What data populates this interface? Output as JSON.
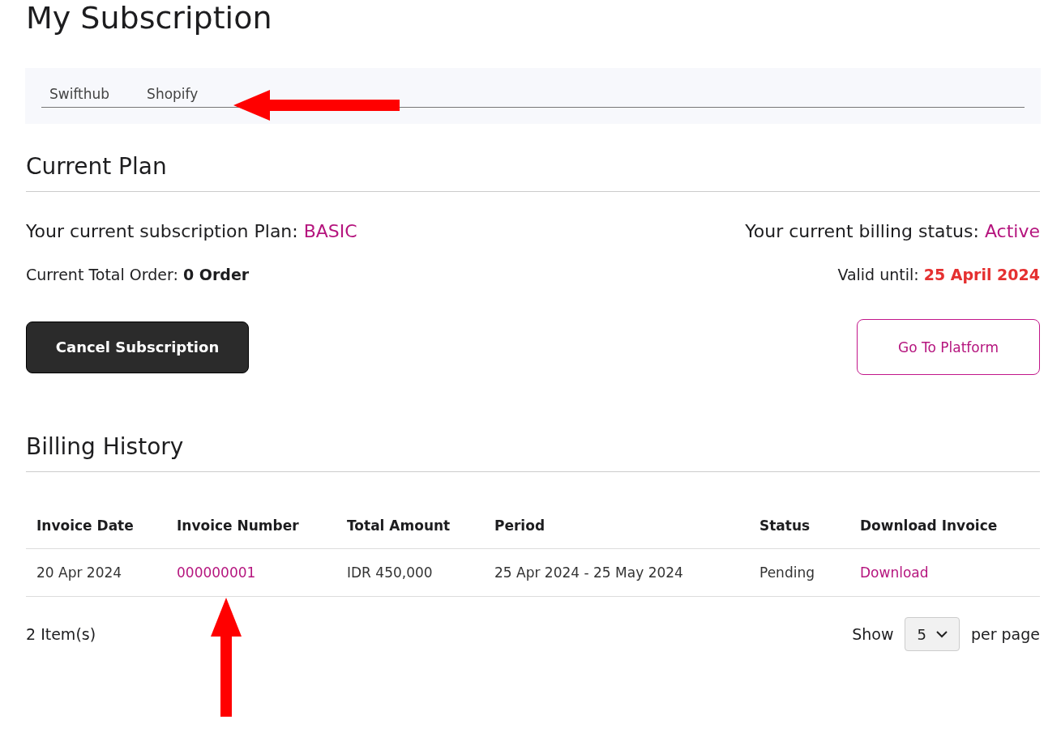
{
  "page_title": "My Subscription",
  "tabs": [
    {
      "label": "Swifthub",
      "selected": false
    },
    {
      "label": "Shopify",
      "selected": false
    }
  ],
  "current_plan": {
    "heading": "Current Plan",
    "plan_label": "Your current subscription Plan: ",
    "plan_value": "BASIC",
    "billing_label": "Your current billing status: ",
    "billing_value": "Active",
    "orders_label": "Current Total Order: ",
    "orders_value": "0 Order",
    "valid_label": "Valid until: ",
    "valid_value": "25 April 2024",
    "cancel_button": "Cancel Subscription",
    "platform_button": "Go To Platform"
  },
  "billing_history": {
    "heading": "Billing History",
    "columns": [
      "Invoice Date",
      "Invoice Number",
      "Total Amount",
      "Period",
      "Status",
      "Download Invoice"
    ],
    "rows": [
      {
        "date": "20 Apr 2024",
        "number": "000000001",
        "amount": "IDR 450,000",
        "period": "25 Apr 2024 - 25 May 2024",
        "status": "Pending",
        "download": "Download"
      }
    ],
    "item_count": "2 Item(s)",
    "show_label": "Show",
    "page_size": "5",
    "per_page_label": "per page"
  }
}
